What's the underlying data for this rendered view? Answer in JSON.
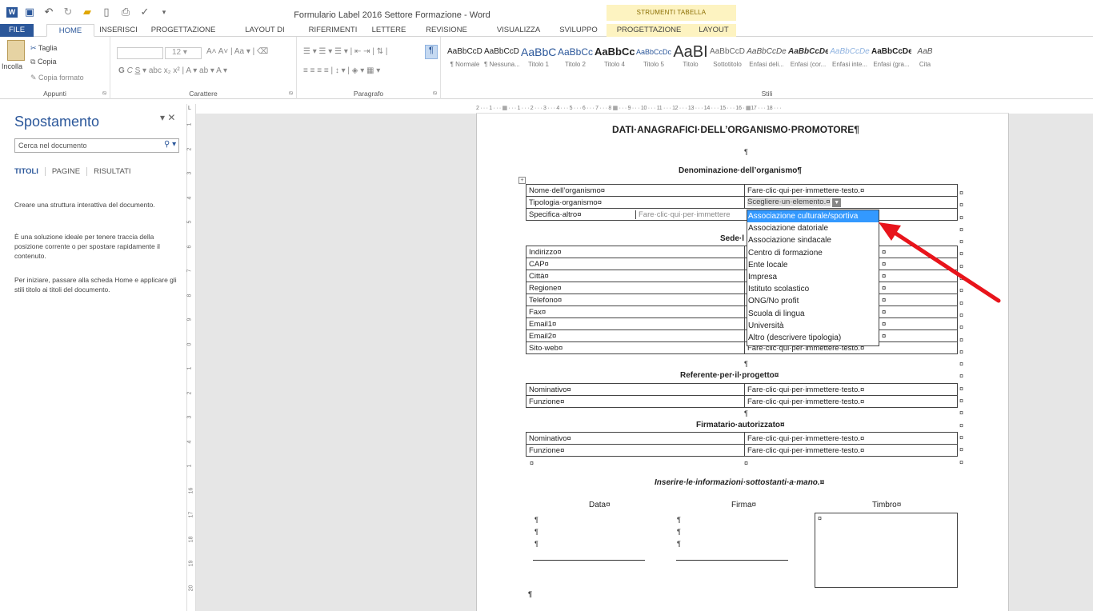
{
  "window": {
    "title": "Formulario Label 2016 Settore Formazione - Word",
    "tools_header": "STRUMENTI TABELLA"
  },
  "tabs": [
    "FILE",
    "HOME",
    "INSERISCI",
    "PROGETTAZIONE",
    "LAYOUT DI PAGINA",
    "RIFERIMENTI",
    "LETTERE",
    "REVISIONE",
    "VISUALIZZA",
    "SVILUPPO",
    "PROGETTAZIONE",
    "LAYOUT"
  ],
  "ribbon": {
    "clipboard": {
      "paste": "Incolla",
      "cut": "Taglia",
      "copy": "Copia",
      "format_painter": "Copia formato",
      "label": "Appunti"
    },
    "font": {
      "size": "12",
      "label": "Carattere"
    },
    "paragraph": {
      "label": "Paragrafo"
    },
    "styles": {
      "label": "Stili",
      "items": [
        {
          "preview": "AaBbCcDc",
          "name": "¶ Normale"
        },
        {
          "preview": "AaBbCcDc",
          "name": "¶ Nessuna..."
        },
        {
          "preview": "AaBbCc",
          "name": "Titolo 1"
        },
        {
          "preview": "AaBbCcD",
          "name": "Titolo 2"
        },
        {
          "preview": "AaBbCc",
          "name": "Titolo 4"
        },
        {
          "preview": "AaBbCcDc",
          "name": "Titolo 5"
        },
        {
          "preview": "AaBI",
          "name": "Titolo"
        },
        {
          "preview": "AaBbCcD",
          "name": "Sottotitolo"
        },
        {
          "preview": "AaBbCcDe",
          "name": "Enfasi deli..."
        },
        {
          "preview": "AaBbCcDe",
          "name": "Enfasi (cor..."
        },
        {
          "preview": "AaBbCcDe",
          "name": "Enfasi inte..."
        },
        {
          "preview": "AaBbCcDe",
          "name": "Enfasi (gra..."
        },
        {
          "preview": "AaB",
          "name": "Cita"
        }
      ]
    }
  },
  "nav": {
    "title": "Spostamento",
    "search_placeholder": "Cerca nel documento",
    "tabs": [
      "TITOLI",
      "PAGINE",
      "RISULTATI"
    ],
    "p1": "Creare una struttura interattiva del documento.",
    "p2": "È una soluzione ideale per tenere traccia della posizione corrente o per spostare rapidamente il contenuto.",
    "p3": "Per iniziare, passare alla scheda Home e applicare gli stili titolo ai titoli del documento."
  },
  "ruler_h": "2 · · · 1 · · · ▦ · · · 1 · · · 2 · · · 3 · · · 4 · · · 5 · · · 6 · · · 7 · · · 8 ▦ · · · 9 · · · 10 · · · 11 · · · 12 · · · 13 · · · 14 · · · 15 · · · 16 · ▦17 · · · 18 · · ·",
  "ruler_v": [
    "1",
    "2",
    "3",
    "4",
    "5",
    "6",
    "7",
    "8",
    "9",
    "0",
    "1",
    "2",
    "3",
    "4",
    "1",
    "16",
    "17",
    "18",
    "19",
    "20"
  ],
  "doc": {
    "heading": "DATI·ANAGRAFICI·DELL’ORGANISMO·PROMOTORE¶",
    "pilcrow": "¶",
    "cellmark": "¤",
    "denom_title": "Denominazione·dell’organismo¶",
    "denom_rows": [
      {
        "label": "Nome·dell’organismo¤",
        "value": "Fare·clic·qui·per·immettere·testo.¤"
      },
      {
        "label": "Tipologia·organismo¤",
        "value": "Scegliere·un·elemento.¤"
      },
      {
        "label": "Specifica·altro¤",
        "value": "Fare·clic·qui·per·immettere"
      }
    ],
    "sede_title": "Sede·l",
    "sede_rows": [
      "Indirizzo¤",
      "CAP¤",
      "Città¤",
      "Regione¤",
      "Telefono¤",
      "Fax¤",
      "Email1¤",
      "Email2¤",
      "Sito·web¤"
    ],
    "sede_last_value": "Fare·clic·qui·per·immettere·testo.¤",
    "ref_title": "Referente·per·il·progetto¤",
    "ref_rows": [
      {
        "label": "Nominativo¤",
        "value": "Fare·clic·qui·per·immettere·testo.¤"
      },
      {
        "label": "Funzione¤",
        "value": "Fare·clic·qui·per·immettere·testo.¤"
      }
    ],
    "firm_title": "Firmatario·autorizzato¤",
    "firm_rows": [
      {
        "label": "Nominativo¤",
        "value": "Fare·clic·qui·per·immettere·testo.¤"
      },
      {
        "label": "Funzione¤",
        "value": "Fare·clic·qui·per·immettere·testo.¤"
      }
    ],
    "handwrite": "Inserire·le·informazioni·sottostanti·a·mano.¤",
    "data_lbl": "Data¤",
    "firma_lbl": "Firma¤",
    "timbro_lbl": "Timbro¤"
  },
  "dropdown": {
    "items": [
      "Associazione culturale/sportiva",
      "Associazione datoriale",
      "Associazione sindacale",
      "Centro di formazione",
      "Ente locale",
      "Impresa",
      "Istituto scolastico",
      "ONG/No profit",
      "Scuola di lingua",
      "Università",
      "Altro (descrivere tipologia)"
    ],
    "selected": 0
  },
  "colors": {
    "word_blue": "#2b579a",
    "tools_yellow": "#fdf3c1",
    "arrow_red": "#e8141b",
    "highlight": "#3399ff"
  }
}
